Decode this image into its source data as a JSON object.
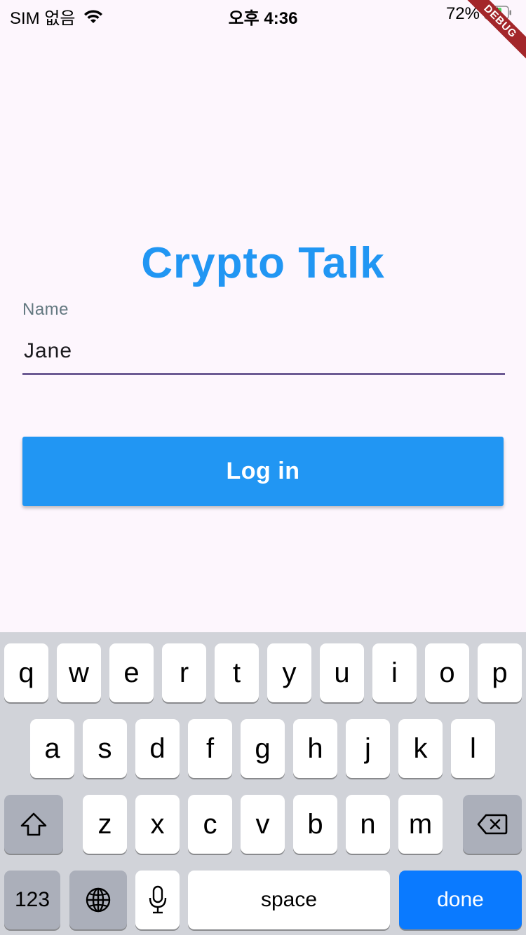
{
  "status_bar": {
    "carrier": "SIM 없음",
    "time": "오후 4:36",
    "battery": "72%"
  },
  "debug_banner": "DEBUG",
  "app": {
    "title": "Crypto Talk",
    "name_field": {
      "label": "Name",
      "value": "Jane"
    },
    "login_button": "Log in"
  },
  "keyboard": {
    "row1": [
      "q",
      "w",
      "e",
      "r",
      "t",
      "y",
      "u",
      "i",
      "o",
      "p"
    ],
    "row2": [
      "a",
      "s",
      "d",
      "f",
      "g",
      "h",
      "j",
      "k",
      "l"
    ],
    "row3": [
      "z",
      "x",
      "c",
      "v",
      "b",
      "n",
      "m"
    ],
    "numbers_key": "123",
    "space_key": "space",
    "done_key": "done",
    "icons": [
      "shift-icon",
      "backspace-icon",
      "globe-icon",
      "microphone-icon"
    ]
  },
  "colors": {
    "accent": "#2196f3",
    "field_underline": "#6c5a93",
    "done_key": "#0a7aff"
  }
}
